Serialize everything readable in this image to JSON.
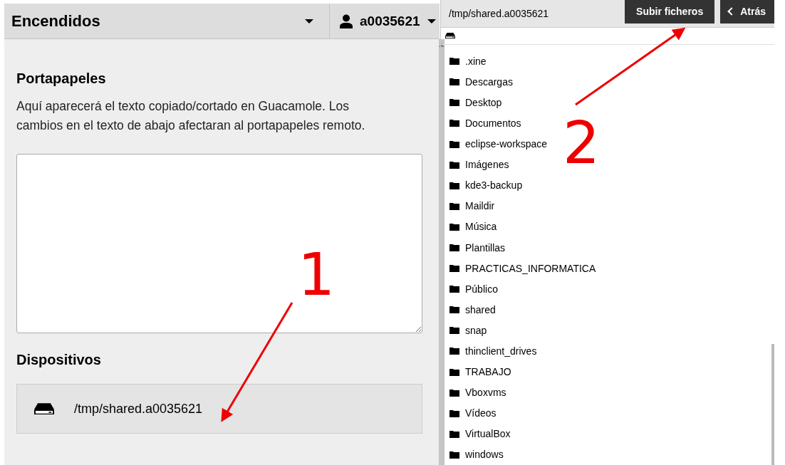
{
  "menu": {
    "title": "Encendidos",
    "user": "a0035621"
  },
  "clipboard": {
    "heading": "Portapapeles",
    "description": "Aquí aparecerá el texto copiado/cortado en Guacamole. Los cambios en el texto de abajo afectaran al portapapeles remoto."
  },
  "devices": {
    "heading": "Dispositivos",
    "items": [
      {
        "name": "/tmp/shared.a0035621"
      }
    ]
  },
  "file_browser": {
    "path": "/tmp/shared.a0035621",
    "buttons": [
      {
        "label": "Subir ficheros",
        "kind": "upload"
      },
      {
        "label": "Atrás",
        "kind": "back"
      }
    ],
    "folders": [
      {
        "name": ".xine"
      },
      {
        "name": "Descargas"
      },
      {
        "name": "Desktop"
      },
      {
        "name": "Documentos"
      },
      {
        "name": "eclipse-workspace"
      },
      {
        "name": "Imágenes"
      },
      {
        "name": "kde3-backup"
      },
      {
        "name": "Maildir"
      },
      {
        "name": "Música"
      },
      {
        "name": "Plantillas"
      },
      {
        "name": "PRACTICAS_INFORMATICA"
      },
      {
        "name": "Público"
      },
      {
        "name": "shared"
      },
      {
        "name": "snap"
      },
      {
        "name": "thinclient_drives"
      },
      {
        "name": "TRABAJO"
      },
      {
        "name": "Vboxvms"
      },
      {
        "name": "Vídeos"
      },
      {
        "name": "VirtualBox"
      },
      {
        "name": "windows"
      }
    ]
  },
  "annotations": [
    {
      "label": "1"
    },
    {
      "label": "2"
    }
  ]
}
